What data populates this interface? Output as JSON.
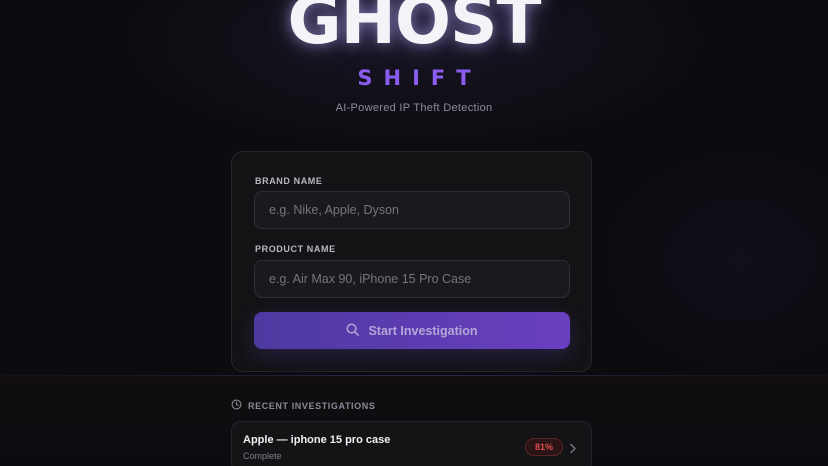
{
  "brand": {
    "logo_text": "GHOST",
    "subtitle": "SHIFT",
    "tagline": "AI-Powered IP Theft Detection"
  },
  "form": {
    "brand_label": "BRAND NAME",
    "brand_placeholder": "e.g. Nike, Apple, Dyson",
    "brand_value": "",
    "product_label": "PRODUCT NAME",
    "product_placeholder": "e.g. Air Max 90, iPhone 15 Pro Case",
    "product_value": "",
    "submit_label": "Start Investigation",
    "submit_icon": "search-icon"
  },
  "recent": {
    "heading": "RECENT INVESTIGATIONS",
    "heading_icon": "clock-icon",
    "items": [
      {
        "title": "Apple — iphone 15 pro case",
        "status": "Complete",
        "score": "81%",
        "icon": "chevron-right-icon"
      }
    ]
  },
  "colors": {
    "accent": "#8a5cf0",
    "button_start": "#4d3aa0",
    "button_end": "#6a3fc0",
    "danger": "#e0504e",
    "background": "#0c0c10"
  }
}
